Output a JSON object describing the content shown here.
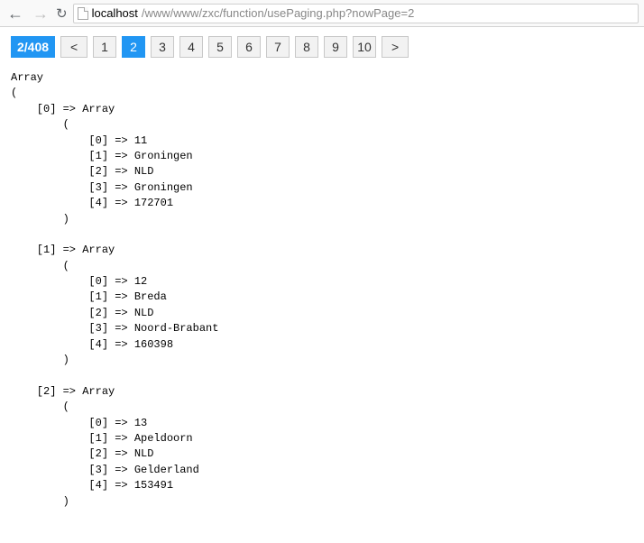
{
  "toolbar": {
    "url_host": "localhost",
    "url_path": "/www/www/zxc/function/usePaging.php?nowPage=2"
  },
  "pagination": {
    "current_page": 2,
    "total_pages": 408,
    "indicator": "2/408",
    "prev_label": "<",
    "next_label": ">",
    "pages": [
      "1",
      "2",
      "3",
      "4",
      "5",
      "6",
      "7",
      "8",
      "9",
      "10"
    ]
  },
  "dump": {
    "root_label": "Array",
    "rows": [
      {
        "index": 0,
        "fields": [
          {
            "k": 0,
            "v": "11"
          },
          {
            "k": 1,
            "v": "Groningen"
          },
          {
            "k": 2,
            "v": "NLD"
          },
          {
            "k": 3,
            "v": "Groningen"
          },
          {
            "k": 4,
            "v": "172701"
          }
        ]
      },
      {
        "index": 1,
        "fields": [
          {
            "k": 0,
            "v": "12"
          },
          {
            "k": 1,
            "v": "Breda"
          },
          {
            "k": 2,
            "v": "NLD"
          },
          {
            "k": 3,
            "v": "Noord-Brabant"
          },
          {
            "k": 4,
            "v": "160398"
          }
        ]
      },
      {
        "index": 2,
        "fields": [
          {
            "k": 0,
            "v": "13"
          },
          {
            "k": 1,
            "v": "Apeldoorn"
          },
          {
            "k": 2,
            "v": "NLD"
          },
          {
            "k": 3,
            "v": "Gelderland"
          },
          {
            "k": 4,
            "v": "153491"
          }
        ]
      }
    ]
  }
}
